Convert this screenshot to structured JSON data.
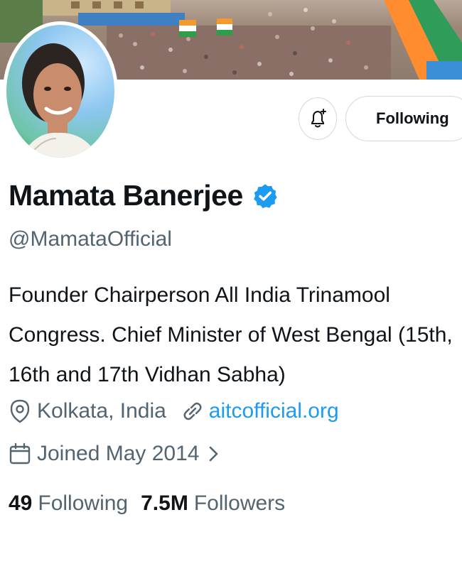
{
  "profile": {
    "name": "Mamata Banerjee",
    "handle": "@MamataOfficial",
    "bio": "Founder Chairperson All India Trinamool Congress. Chief Minister of West Bengal (15th, 16th and 17th Vidhan Sabha)",
    "location": "Kolkata, India",
    "website": "aitcofficial.org",
    "joined": "Joined May 2014",
    "verified": true
  },
  "actions": {
    "following_label": "Following"
  },
  "stats": {
    "following_count": "49",
    "following_label": "Following",
    "followers_count": "7.5M",
    "followers_label": "Followers"
  },
  "icons": {
    "verified": "verified-badge-icon",
    "location": "location-pin-icon",
    "link": "link-icon",
    "calendar": "calendar-icon",
    "bell": "notification-bell-plus-icon",
    "chevron": "chevron-right-icon"
  },
  "colors": {
    "accent": "#1d9bf0",
    "text_primary": "#0f1419",
    "text_secondary": "#536471",
    "border": "#cfd9de"
  }
}
